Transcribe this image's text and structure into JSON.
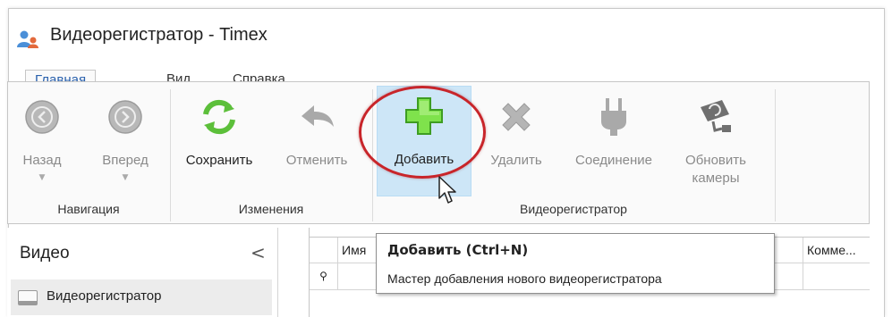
{
  "window": {
    "title": "Видеорегистратор - Timex",
    "icon": "app-users-icon"
  },
  "tabs": [
    {
      "label": "Главная",
      "active": true
    },
    {
      "label": "Вид",
      "active": false
    },
    {
      "label": "Справка",
      "active": false
    }
  ],
  "ribbon": {
    "groups": {
      "navigation": "Навигация",
      "changes": "Изменения",
      "recorder": "Видеорегистратор"
    },
    "buttons": {
      "back": {
        "label": "Назад",
        "icon": "arrow-left-icon",
        "enabled": false
      },
      "forward": {
        "label": "Вперед",
        "icon": "arrow-right-icon",
        "enabled": false
      },
      "save": {
        "label": "Сохранить",
        "icon": "refresh-icon",
        "enabled": true
      },
      "cancel": {
        "label": "Отменить",
        "icon": "undo-icon",
        "enabled": false
      },
      "add": {
        "label": "Добавить",
        "icon": "plus-icon",
        "enabled": true
      },
      "delete": {
        "label": "Удалить",
        "icon": "x-icon",
        "enabled": false
      },
      "connect": {
        "label": "Соединение",
        "icon": "plug-icon",
        "enabled": false
      },
      "refresh_cameras": {
        "label_line1": "Обновить",
        "label_line2": "камеры",
        "icon": "camera-refresh-icon",
        "enabled": false
      }
    }
  },
  "left_pane": {
    "title": "Видео",
    "collapse": "<",
    "items": [
      {
        "label": "Видеорегистратор",
        "icon": "hdd-icon"
      }
    ]
  },
  "grid": {
    "columns": [
      "Имя",
      "Комме..."
    ],
    "filter_icon": "pin-icon"
  },
  "tooltip": {
    "title": "Добавить (Ctrl+N)",
    "body": "Мастер добавления нового видеорегистратора"
  },
  "colors": {
    "accent": "#2a61ad",
    "highlight": "#cde6f7",
    "annotation": "#c8252a",
    "add_green": "#4cc62e"
  }
}
